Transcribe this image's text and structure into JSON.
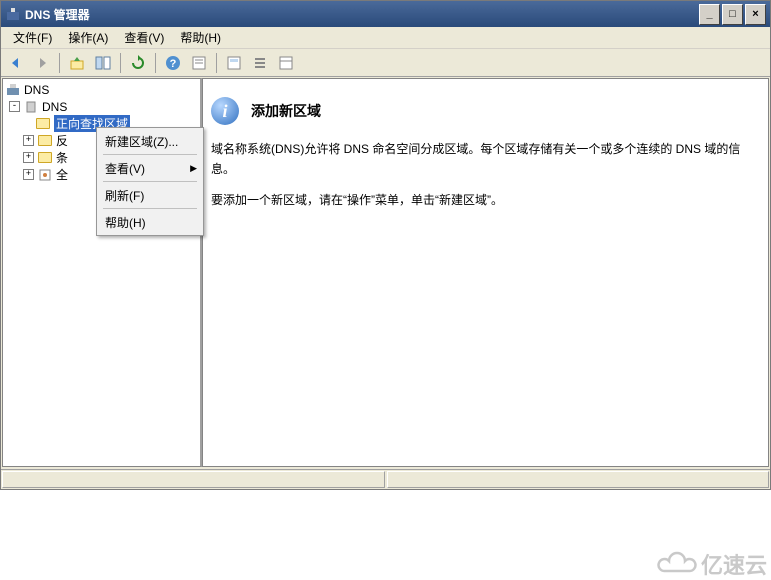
{
  "window": {
    "title": "DNS 管理器"
  },
  "titlebar": {
    "minimize": "_",
    "maximize": "□",
    "close": "×"
  },
  "menubar": {
    "file": "文件(F)",
    "action": "操作(A)",
    "view": "查看(V)",
    "help": "帮助(H)"
  },
  "tree": {
    "root": "DNS",
    "server": "DNS",
    "items": [
      {
        "label": "正向查找区域",
        "selected": true
      },
      {
        "label": "反",
        "collapsed": true
      },
      {
        "label": "条",
        "collapsed": true
      },
      {
        "label": "全",
        "collapsed": true
      }
    ]
  },
  "context_menu": {
    "new_zone": "新建区域(Z)...",
    "view": "查看(V)",
    "refresh": "刷新(F)",
    "help": "帮助(H)"
  },
  "detail": {
    "title": "添加新区域",
    "p1": "域名称系统(DNS)允许将 DNS 命名空间分成区域。每个区域存储有关一个或多个连续的 DNS 域的信息。",
    "p2": "要添加一个新区域，请在“操作”菜单，单击“新建区域”。"
  },
  "watermark": "亿速云"
}
